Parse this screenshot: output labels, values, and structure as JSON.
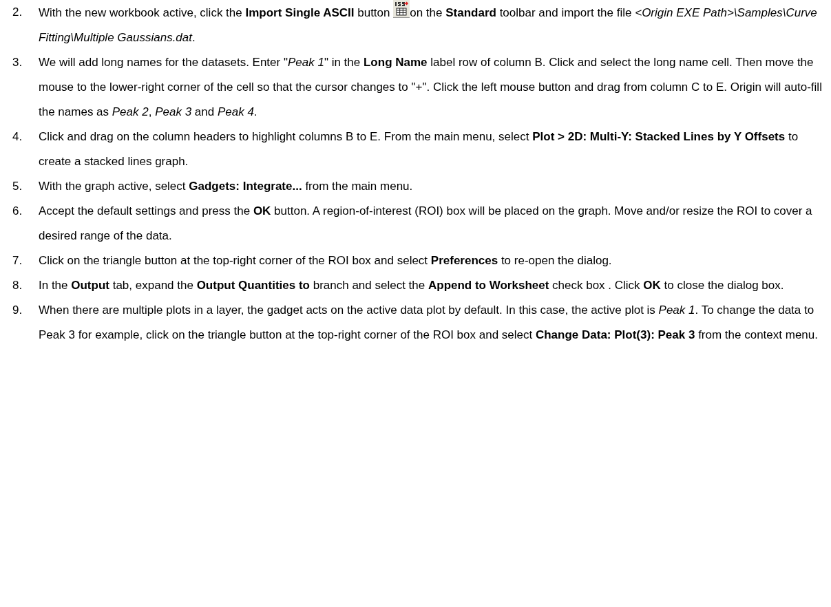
{
  "steps": [
    {
      "number": "2.",
      "parts": [
        {
          "kind": "text",
          "text": "With the new workbook active, click the **Import Single ASCII** button "
        },
        {
          "kind": "icon"
        },
        {
          "kind": "text",
          "text": "on the **Standard** toolbar and import the file *<Origin EXE Path>\\Samples\\Curve Fitting\\Multiple Gaussians.dat*."
        }
      ]
    },
    {
      "number": "3.",
      "parts": [
        {
          "kind": "text",
          "text": "We will add long names for the datasets. Enter \"*Peak 1*\" in the **Long Name** label row of column B. Click and select the long name cell. Then move the mouse to the lower-right corner of the cell so that the cursor changes to \"+\". Click the left mouse button and drag from column C to E. Origin will auto-fill the names as *Peak 2*, *Peak 3* and *Peak 4*."
        }
      ]
    },
    {
      "number": "4.",
      "parts": [
        {
          "kind": "text",
          "text": "Click and drag on the column headers to highlight columns B to E. From the main menu, select **Plot > 2D: Multi-Y: Stacked Lines by Y Offsets** to create a stacked lines graph."
        }
      ]
    },
    {
      "number": "5.",
      "parts": [
        {
          "kind": "text",
          "text": "With the graph active, select **Gadgets: Integrate...** from the main menu."
        }
      ]
    },
    {
      "number": "6.",
      "parts": [
        {
          "kind": "text",
          "text": "Accept the default settings and press the **OK** button. A region-of-interest (ROI) box will be placed on the graph. Move and/or resize the ROI to cover a desired range of the data."
        }
      ]
    },
    {
      "number": "7.",
      "parts": [
        {
          "kind": "text",
          "text": "Click on the triangle button at the top-right corner of the ROI box and select **Preferences** to re-open the dialog."
        }
      ]
    },
    {
      "number": "8.",
      "parts": [
        {
          "kind": "text",
          "text": "In the **Output** tab, expand the **Output Quantities to** branch and select the **Append to Worksheet** check box . Click **OK** to close the dialog box."
        }
      ]
    },
    {
      "number": "9.",
      "parts": [
        {
          "kind": "text",
          "text": "When there are multiple plots in a layer, the gadget acts on the active data plot by default. In this case, the active plot is *Peak 1*. To change the data to Peak 3 for example, click on the triangle button at the top-right corner of the ROI box and select **Change Data: Plot(3): Peak 3** from the context menu."
        }
      ]
    }
  ]
}
